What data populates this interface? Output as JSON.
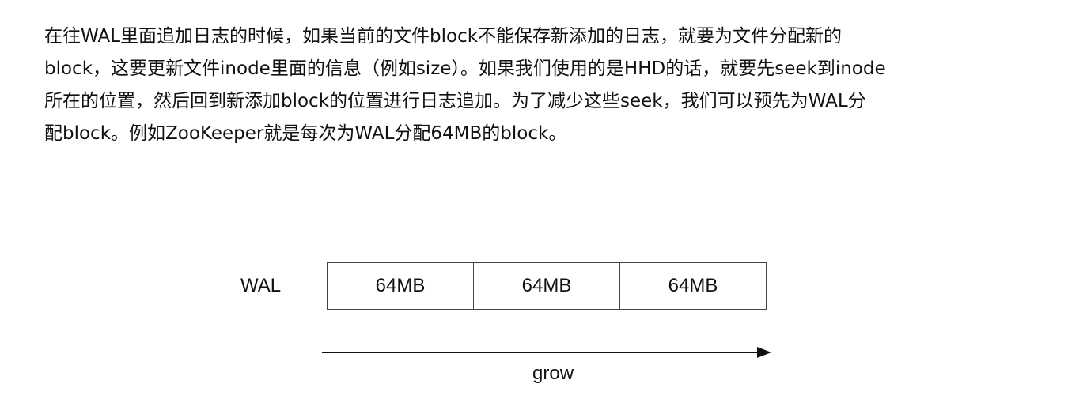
{
  "paragraph": {
    "lines": [
      "在往WAL里面追加日志的时候，如果当前的文件block不能保存新添加的日志，就要为文件分配新的",
      "block，这要更新文件inode里面的信息（例如size）。如果我们使用的是HHD的话，就要先seek到inode",
      "所在的位置，然后回到新添加block的位置进行日志追加。为了减少这些seek，我们可以预先为WAL分",
      "配block。例如ZooKeeper就是每次为WAL分配64MB的block。"
    ]
  },
  "diagram": {
    "wal_label": "WAL",
    "blocks": [
      {
        "label": "64MB"
      },
      {
        "label": "64MB"
      },
      {
        "label": "64MB"
      }
    ],
    "arrow_label": "grow",
    "colors": {
      "stroke": "#444444",
      "arrow": "#111111",
      "text": "#111111"
    }
  }
}
